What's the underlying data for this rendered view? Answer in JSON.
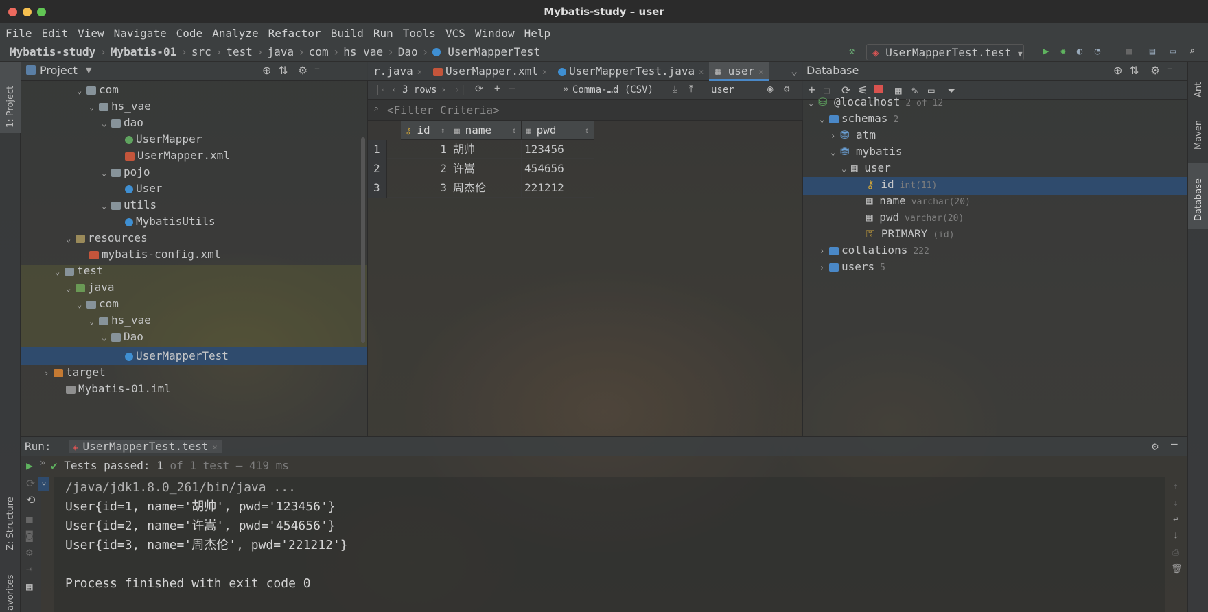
{
  "window": {
    "title": "Mybatis-study – user"
  },
  "menu": [
    "File",
    "Edit",
    "View",
    "Navigate",
    "Code",
    "Analyze",
    "Refactor",
    "Build",
    "Run",
    "Tools",
    "VCS",
    "Window",
    "Help"
  ],
  "breadcrumbs": [
    "Mybatis-study",
    "Mybatis-01",
    "src",
    "test",
    "java",
    "com",
    "hs_vae",
    "Dao",
    "UserMapperTest"
  ],
  "run_config": "UserMapperTest.test",
  "left_stripe": {
    "project": "1: Project",
    "structure": "Z: Structure",
    "favorites": "avorites"
  },
  "right_stripe": {
    "ant": "Ant",
    "maven": "Maven",
    "database": "Database"
  },
  "project": {
    "title": "Project",
    "tree": [
      {
        "label": "com",
        "icon": "folder"
      },
      {
        "label": "hs_vae",
        "icon": "folder"
      },
      {
        "label": "dao",
        "icon": "folder"
      },
      {
        "label": "UserMapper",
        "icon": "interface"
      },
      {
        "label": "UserMapper.xml",
        "icon": "xml-file"
      },
      {
        "label": "pojo",
        "icon": "folder"
      },
      {
        "label": "User",
        "icon": "class"
      },
      {
        "label": "utils",
        "icon": "folder"
      },
      {
        "label": "MybatisUtils",
        "icon": "class"
      },
      {
        "label": "resources",
        "icon": "resources-folder"
      },
      {
        "label": "mybatis-config.xml",
        "icon": "xml-file"
      },
      {
        "label": "test",
        "icon": "folder"
      },
      {
        "label": "java",
        "icon": "test-source-folder"
      },
      {
        "label": "com",
        "icon": "folder"
      },
      {
        "label": "hs_vae",
        "icon": "folder"
      },
      {
        "label": "Dao",
        "icon": "folder"
      },
      {
        "label": "UserMapperTest",
        "icon": "class"
      },
      {
        "label": "target",
        "icon": "excluded-folder"
      },
      {
        "label": "Mybatis-01.iml",
        "icon": "iml-file"
      }
    ]
  },
  "editor": {
    "tabs": [
      "r.java",
      "UserMapper.xml",
      "UserMapperTest.java",
      "user"
    ],
    "active_tab": "user",
    "grid_toolbar": {
      "rows": "3 rows",
      "export": "Comma-…d (CSV)",
      "target": "user"
    },
    "filter_placeholder": "<Filter Criteria>",
    "columns": [
      "id",
      "name",
      "pwd"
    ],
    "rows": [
      {
        "n": "1",
        "id": "1",
        "name": "胡帅",
        "pwd": "123456"
      },
      {
        "n": "2",
        "id": "2",
        "name": "许嵩",
        "pwd": "454656"
      },
      {
        "n": "3",
        "id": "3",
        "name": "周杰伦",
        "pwd": "221212"
      }
    ]
  },
  "database": {
    "title": "Database",
    "host": {
      "label": "@localhost",
      "count": "2 of 12"
    },
    "schemas": {
      "label": "schemas",
      "count": "2"
    },
    "atm": "atm",
    "mybatis": "mybatis",
    "table": "user",
    "columns": [
      {
        "name": "id",
        "type": "int(11)"
      },
      {
        "name": "name",
        "type": "varchar(20)"
      },
      {
        "name": "pwd",
        "type": "varchar(20)"
      }
    ],
    "primary": {
      "name": "PRIMARY",
      "cols": "(id)"
    },
    "collations": {
      "label": "collations",
      "count": "222"
    },
    "users": {
      "label": "users",
      "count": "5"
    }
  },
  "run": {
    "label": "Run:",
    "tab": "UserMapperTest.test",
    "status": {
      "prefix": "Tests passed:",
      "passed": "1",
      "of": "of 1 test",
      "time": "– 419 ms"
    },
    "console": [
      "/java/jdk1.8.0_261/bin/java ...",
      "User{id=1, name='胡帅', pwd='123456'}",
      "User{id=2, name='许嵩', pwd='454656'}",
      "User{id=3, name='周杰伦', pwd='221212'}",
      "",
      "Process finished with exit code 0"
    ]
  },
  "colors": {
    "selection": "#2f4b6d",
    "accent": "#4a88c7",
    "success": "#5fa35f",
    "folder": "#87939a"
  }
}
